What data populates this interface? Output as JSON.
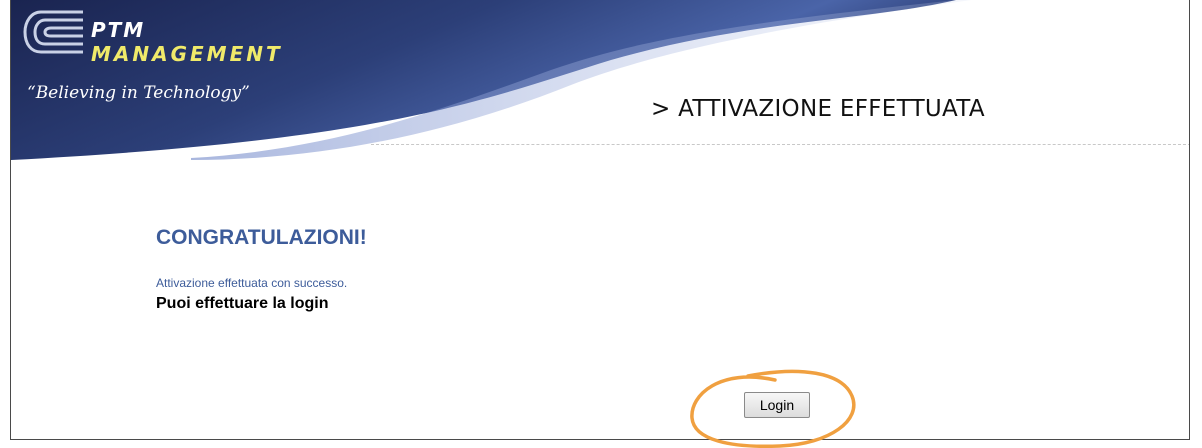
{
  "brand": {
    "name_line1": "PTM",
    "name_line2": "MANAGEMENT",
    "tagline": "“Believing in Technology”"
  },
  "page": {
    "heading": "> ATTIVAZIONE EFFETTUATA"
  },
  "content": {
    "title": "CONGRATULAZIONI!",
    "message": "Attivazione effettuata con successo.",
    "instruction": "Puoi effettuare la login"
  },
  "actions": {
    "login_label": "Login"
  },
  "colors": {
    "banner_dark": "#1d2a5a",
    "banner_mid": "#3a5290",
    "title_blue": "#3d5c9a",
    "logo_yellow": "#f0ea6a",
    "annotation_orange": "#f0a040"
  }
}
